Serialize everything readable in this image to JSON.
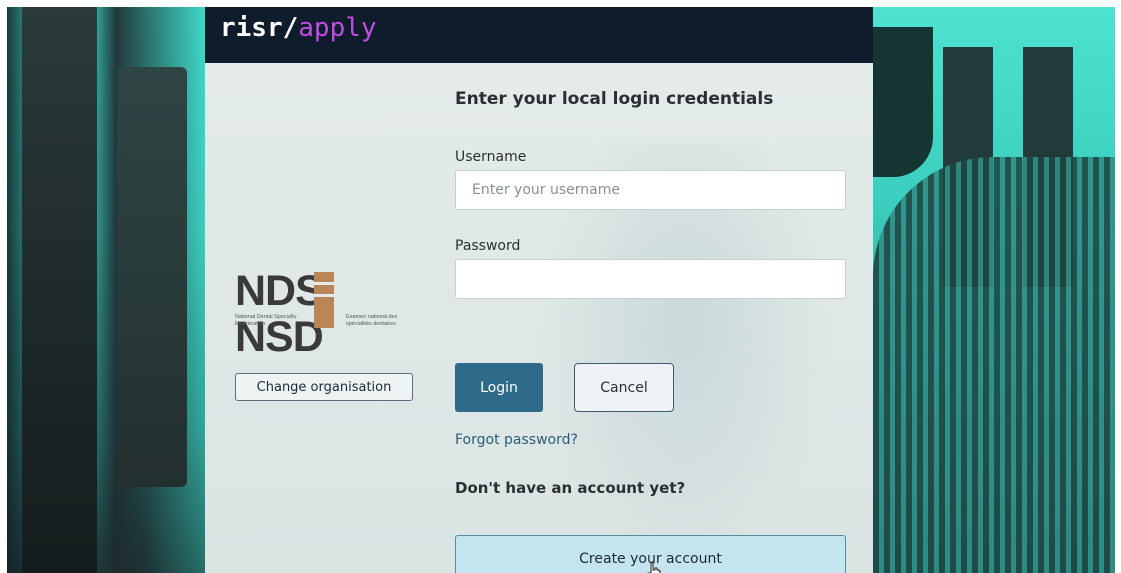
{
  "brand": {
    "part1": "risr",
    "slash": "/",
    "part2": "apply"
  },
  "organisation": {
    "logo_text_left": "NDS",
    "logo_text_right": "NSD",
    "logo_sub_left": "National Dental Specialty Examination",
    "logo_sub_right": "Examen national des spécialités dentaires",
    "change_button": "Change organisation"
  },
  "login_form": {
    "heading": "Enter your local login credentials",
    "username_label": "Username",
    "username_placeholder": "Enter your username",
    "username_value": "",
    "password_label": "Password",
    "password_value": "",
    "login_button": "Login",
    "cancel_button": "Cancel",
    "forgot_link": "Forgot password?",
    "no_account_text": "Don't have an account yet?",
    "create_button": "Create your account"
  },
  "colors": {
    "topbar": "#0e1c2c",
    "brand_accent": "#c14ce0",
    "primary_button": "#2e6b8a",
    "create_button_bg": "#c4e4ef",
    "background_teal": "#3fd9c9",
    "logo_gold": "#b98657"
  }
}
